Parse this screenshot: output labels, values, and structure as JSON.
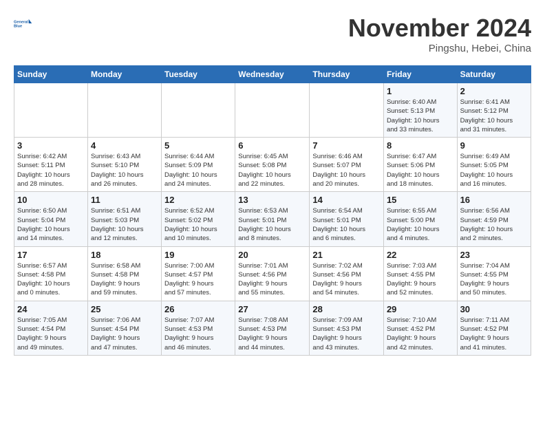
{
  "header": {
    "logo": {
      "line1": "General",
      "line2": "Blue"
    },
    "title": "November 2024",
    "location": "Pingshu, Hebei, China"
  },
  "weekdays": [
    "Sunday",
    "Monday",
    "Tuesday",
    "Wednesday",
    "Thursday",
    "Friday",
    "Saturday"
  ],
  "weeks": [
    [
      {
        "day": "",
        "info": ""
      },
      {
        "day": "",
        "info": ""
      },
      {
        "day": "",
        "info": ""
      },
      {
        "day": "",
        "info": ""
      },
      {
        "day": "",
        "info": ""
      },
      {
        "day": "1",
        "info": "Sunrise: 6:40 AM\nSunset: 5:13 PM\nDaylight: 10 hours\nand 33 minutes."
      },
      {
        "day": "2",
        "info": "Sunrise: 6:41 AM\nSunset: 5:12 PM\nDaylight: 10 hours\nand 31 minutes."
      }
    ],
    [
      {
        "day": "3",
        "info": "Sunrise: 6:42 AM\nSunset: 5:11 PM\nDaylight: 10 hours\nand 28 minutes."
      },
      {
        "day": "4",
        "info": "Sunrise: 6:43 AM\nSunset: 5:10 PM\nDaylight: 10 hours\nand 26 minutes."
      },
      {
        "day": "5",
        "info": "Sunrise: 6:44 AM\nSunset: 5:09 PM\nDaylight: 10 hours\nand 24 minutes."
      },
      {
        "day": "6",
        "info": "Sunrise: 6:45 AM\nSunset: 5:08 PM\nDaylight: 10 hours\nand 22 minutes."
      },
      {
        "day": "7",
        "info": "Sunrise: 6:46 AM\nSunset: 5:07 PM\nDaylight: 10 hours\nand 20 minutes."
      },
      {
        "day": "8",
        "info": "Sunrise: 6:47 AM\nSunset: 5:06 PM\nDaylight: 10 hours\nand 18 minutes."
      },
      {
        "day": "9",
        "info": "Sunrise: 6:49 AM\nSunset: 5:05 PM\nDaylight: 10 hours\nand 16 minutes."
      }
    ],
    [
      {
        "day": "10",
        "info": "Sunrise: 6:50 AM\nSunset: 5:04 PM\nDaylight: 10 hours\nand 14 minutes."
      },
      {
        "day": "11",
        "info": "Sunrise: 6:51 AM\nSunset: 5:03 PM\nDaylight: 10 hours\nand 12 minutes."
      },
      {
        "day": "12",
        "info": "Sunrise: 6:52 AM\nSunset: 5:02 PM\nDaylight: 10 hours\nand 10 minutes."
      },
      {
        "day": "13",
        "info": "Sunrise: 6:53 AM\nSunset: 5:01 PM\nDaylight: 10 hours\nand 8 minutes."
      },
      {
        "day": "14",
        "info": "Sunrise: 6:54 AM\nSunset: 5:01 PM\nDaylight: 10 hours\nand 6 minutes."
      },
      {
        "day": "15",
        "info": "Sunrise: 6:55 AM\nSunset: 5:00 PM\nDaylight: 10 hours\nand 4 minutes."
      },
      {
        "day": "16",
        "info": "Sunrise: 6:56 AM\nSunset: 4:59 PM\nDaylight: 10 hours\nand 2 minutes."
      }
    ],
    [
      {
        "day": "17",
        "info": "Sunrise: 6:57 AM\nSunset: 4:58 PM\nDaylight: 10 hours\nand 0 minutes."
      },
      {
        "day": "18",
        "info": "Sunrise: 6:58 AM\nSunset: 4:58 PM\nDaylight: 9 hours\nand 59 minutes."
      },
      {
        "day": "19",
        "info": "Sunrise: 7:00 AM\nSunset: 4:57 PM\nDaylight: 9 hours\nand 57 minutes."
      },
      {
        "day": "20",
        "info": "Sunrise: 7:01 AM\nSunset: 4:56 PM\nDaylight: 9 hours\nand 55 minutes."
      },
      {
        "day": "21",
        "info": "Sunrise: 7:02 AM\nSunset: 4:56 PM\nDaylight: 9 hours\nand 54 minutes."
      },
      {
        "day": "22",
        "info": "Sunrise: 7:03 AM\nSunset: 4:55 PM\nDaylight: 9 hours\nand 52 minutes."
      },
      {
        "day": "23",
        "info": "Sunrise: 7:04 AM\nSunset: 4:55 PM\nDaylight: 9 hours\nand 50 minutes."
      }
    ],
    [
      {
        "day": "24",
        "info": "Sunrise: 7:05 AM\nSunset: 4:54 PM\nDaylight: 9 hours\nand 49 minutes."
      },
      {
        "day": "25",
        "info": "Sunrise: 7:06 AM\nSunset: 4:54 PM\nDaylight: 9 hours\nand 47 minutes."
      },
      {
        "day": "26",
        "info": "Sunrise: 7:07 AM\nSunset: 4:53 PM\nDaylight: 9 hours\nand 46 minutes."
      },
      {
        "day": "27",
        "info": "Sunrise: 7:08 AM\nSunset: 4:53 PM\nDaylight: 9 hours\nand 44 minutes."
      },
      {
        "day": "28",
        "info": "Sunrise: 7:09 AM\nSunset: 4:53 PM\nDaylight: 9 hours\nand 43 minutes."
      },
      {
        "day": "29",
        "info": "Sunrise: 7:10 AM\nSunset: 4:52 PM\nDaylight: 9 hours\nand 42 minutes."
      },
      {
        "day": "30",
        "info": "Sunrise: 7:11 AM\nSunset: 4:52 PM\nDaylight: 9 hours\nand 41 minutes."
      }
    ]
  ]
}
